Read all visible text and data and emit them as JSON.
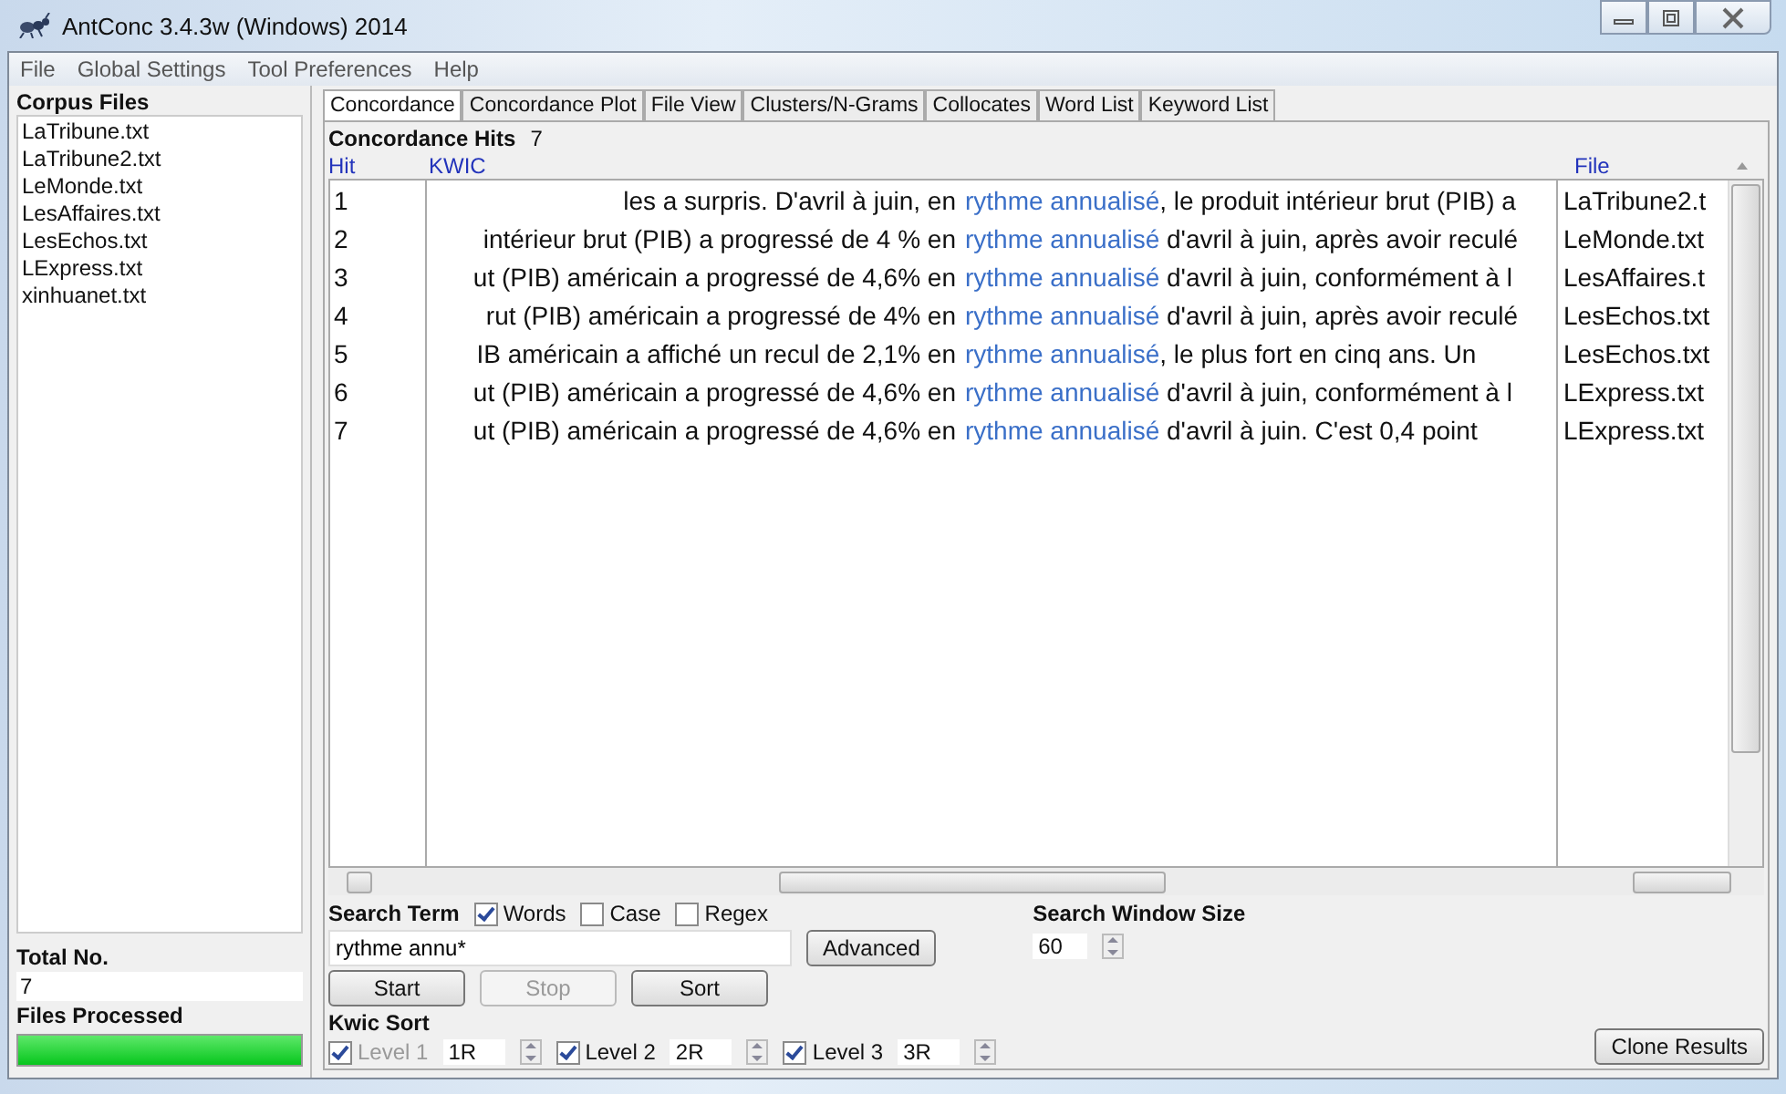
{
  "window": {
    "title": "AntConc 3.4.3w (Windows) 2014"
  },
  "menu": [
    "File",
    "Global Settings",
    "Tool Preferences",
    "Help"
  ],
  "corpus_files": {
    "title": "Corpus Files",
    "items": [
      "LaTribune.txt",
      "LaTribune2.txt",
      "LeMonde.txt",
      "LesAffaires.txt",
      "LesEchos.txt",
      "LExpress.txt",
      "xinhuanet.txt"
    ]
  },
  "total_no": {
    "label": "Total No.",
    "value": "7"
  },
  "files_processed": {
    "label": "Files Processed",
    "level": 1
  },
  "tabs": [
    {
      "label": "Concordance",
      "selected": true
    },
    {
      "label": "Concordance Plot",
      "selected": false
    },
    {
      "label": "File View",
      "selected": false
    },
    {
      "label": "Clusters/N-Grams",
      "selected": false
    },
    {
      "label": "Collocates",
      "selected": false
    },
    {
      "label": "Word List",
      "selected": false
    },
    {
      "label": "Keyword List",
      "selected": false
    }
  ],
  "concordance": {
    "hits_label": "Concordance Hits",
    "hits": "7",
    "columns": [
      "Hit",
      "KWIC",
      "File"
    ],
    "rows": [
      {
        "hit": "1",
        "left": "les a surpris. D'avril à juin, en",
        "keyword": "rythme annualisé",
        "right": ", le produit intérieur brut (PIB) a",
        "file": "LaTribune2.t"
      },
      {
        "hit": "2",
        "left": "intérieur brut (PIB) a progressé de 4 % en",
        "keyword": "rythme annualisé",
        "right": " d'avril à juin, après avoir reculé",
        "file": "LeMonde.txt"
      },
      {
        "hit": "3",
        "left": "ut (PIB) américain a progressé de 4,6% en",
        "keyword": "rythme annualisé",
        "right": " d'avril à juin, conformément à l",
        "file": "LesAffaires.t"
      },
      {
        "hit": "4",
        "left": "rut (PIB) américain a progressé de 4% en",
        "keyword": "rythme annualisé",
        "right": " d'avril à juin, après avoir reculé",
        "file": "LesEchos.txt"
      },
      {
        "hit": "5",
        "left": "IB américain a affiché un recul de 2,1% en",
        "keyword": "rythme annualisé",
        "right": ", le plus fort en cinq ans. Un",
        "file": "LesEchos.txt"
      },
      {
        "hit": "6",
        "left": "ut (PIB) américain a progressé de 4,6% en",
        "keyword": "rythme annualisé",
        "right": " d'avril à juin, conformément à l",
        "file": "LExpress.txt"
      },
      {
        "hit": "7",
        "left": "ut (PIB) américain a progressé de 4,6% en",
        "keyword": "rythme annualisé",
        "right": " d'avril à juin. C'est 0,4 point",
        "file": "LExpress.txt"
      }
    ]
  },
  "search": {
    "label": "Search Term",
    "options": [
      {
        "label": "Words",
        "checked": true
      },
      {
        "label": "Case",
        "checked": false
      },
      {
        "label": "Regex",
        "checked": false
      }
    ],
    "value": "rythme annu*",
    "advanced": "Advanced",
    "window_size_label": "Search Window Size",
    "window_size": "60"
  },
  "buttons": [
    {
      "label": "Start",
      "disabled": false
    },
    {
      "label": "Stop",
      "disabled": true
    },
    {
      "label": "Sort",
      "disabled": false
    }
  ],
  "kwic_sort": {
    "label": "Kwic Sort",
    "levels": [
      {
        "label": "Level 1",
        "value": "1R",
        "checked": true,
        "disabled": true
      },
      {
        "label": "Level 2",
        "value": "2R",
        "checked": true,
        "disabled": false
      },
      {
        "label": "Level 3",
        "value": "3R",
        "checked": true,
        "disabled": false
      }
    ]
  },
  "clone_button": "Clone Results"
}
